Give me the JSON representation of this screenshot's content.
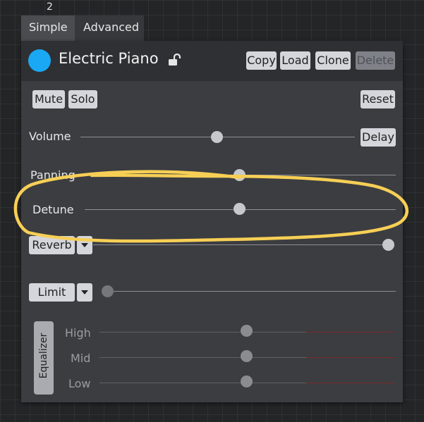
{
  "track_index": "2",
  "tabs": [
    {
      "label": "Simple",
      "active": true
    },
    {
      "label": "Advanced",
      "active": false
    }
  ],
  "instrument": {
    "name": "Electric Piano",
    "color": "#1aa8f5",
    "lock_icon": "unlock-icon"
  },
  "header_buttons": {
    "copy": "Copy",
    "load": "Load",
    "clone": "Clone",
    "delete": "Delete"
  },
  "buttons": {
    "mute": "Mute",
    "solo": "Solo",
    "reset": "Reset",
    "delay": "Delay",
    "reverb": "Reverb",
    "limit": "Limit"
  },
  "controls": {
    "volume": {
      "label": "Volume",
      "value": 0.5
    },
    "panning": {
      "label": "Panning",
      "value": 0.5
    },
    "detune": {
      "label": "Detune",
      "value": 0.5
    },
    "reverb": {
      "value": 1.0
    },
    "limit": {
      "value": 0.0
    }
  },
  "equalizer": {
    "label": "Equalizer",
    "bands": [
      {
        "label": "High",
        "value": 0.5
      },
      {
        "label": "Mid",
        "value": 0.5
      },
      {
        "label": "Low",
        "value": 0.5
      }
    ]
  },
  "annotation": {
    "color": "#f7cf55"
  }
}
